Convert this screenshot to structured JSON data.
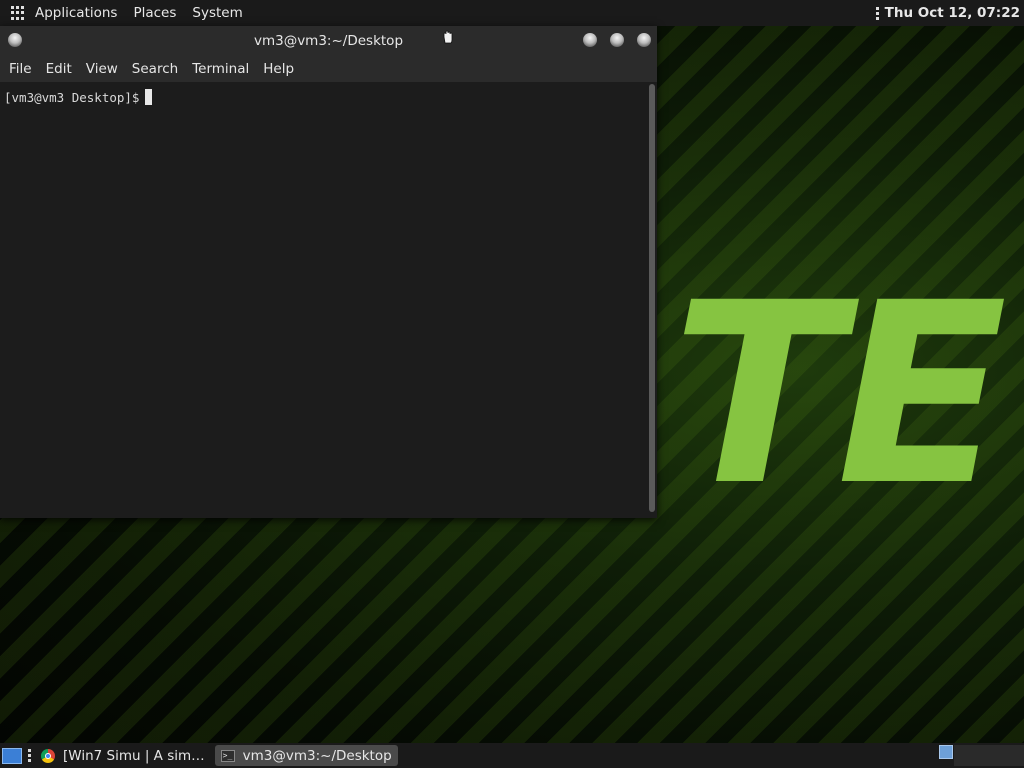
{
  "top_panel": {
    "menus": [
      "Applications",
      "Places",
      "System"
    ],
    "clock": "Thu Oct 12, 07:22"
  },
  "desktop": {
    "wallpaper_text": "TE",
    "wallpaper_color": "#86c441"
  },
  "terminal": {
    "title": "vm3@vm3:~/Desktop",
    "menu": [
      "File",
      "Edit",
      "View",
      "Search",
      "Terminal",
      "Help"
    ],
    "prompt": "[vm3@vm3 Desktop]$"
  },
  "taskbar": {
    "tasks": [
      {
        "icon": "chrome-icon",
        "label": "[Win7 Simu | A sim…",
        "active": false
      },
      {
        "icon": "terminal-icon",
        "label": "vm3@vm3:~/Desktop",
        "active": true
      }
    ]
  }
}
